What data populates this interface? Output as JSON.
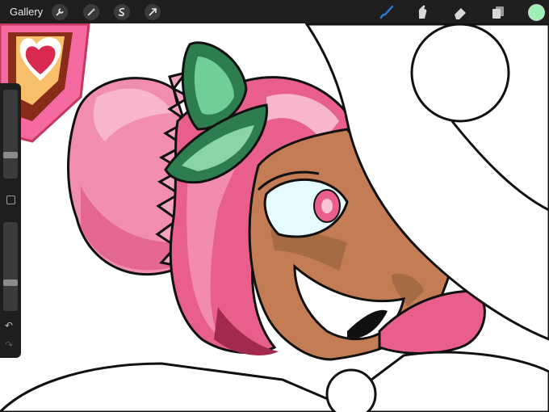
{
  "toolbar": {
    "gallery_label": "Gallery",
    "left_tools": [
      "wrench-icon",
      "magic-wand-icon",
      "selection-icon",
      "transform-arrow-icon"
    ],
    "right_tools": [
      "brush-icon",
      "smudge-icon",
      "eraser-icon",
      "layers-icon"
    ],
    "active_tool": "brush-icon",
    "active_tool_color": "#2f7bd8",
    "current_color": "#9ef0b5"
  },
  "sidebar": {
    "brush_size_level": 0.25,
    "opacity_level": 0.3,
    "undo_icon": "undo-icon",
    "redo_icon": "redo-icon",
    "modify_button_icon": "square-modify-icon"
  },
  "canvas": {
    "skin_color": "#c47c54",
    "hair_color": "#e85f8c",
    "hair_shadow": "#a32a4f",
    "leaf_color": "#2e7d4f"
  }
}
